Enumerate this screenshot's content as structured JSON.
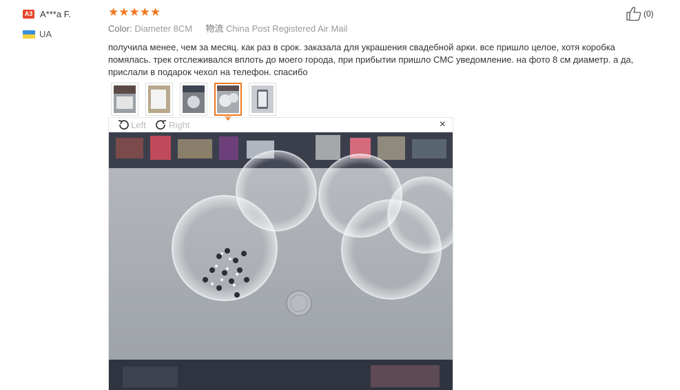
{
  "reviewer": {
    "level_badge": "A3",
    "name": "A***a F.",
    "country_code": "UA"
  },
  "rating": {
    "stars": 5,
    "max": 5,
    "star_color": "#f0781e"
  },
  "helpful": {
    "count_label": "(0)"
  },
  "order_meta": {
    "color_key": "Color:",
    "color_value": "Diameter 8CM",
    "shipping_key": "物流",
    "shipping_value": "China Post Registered Air Mail"
  },
  "review_text": "получила менее, чем за месяц. как раз в срок. заказала для украшения свадебной арки. все пришло целое, хотя коробка помялась. трек отслеживался вплоть до моего города, при прибытии пришло СМС уведомление. на фото 8 см диаметр. а да, прислали в подарок чехол на телефон. спасибо",
  "thumbnails": {
    "count": 5,
    "active_index": 3
  },
  "viewer": {
    "rotate_left_label": "Left",
    "rotate_right_label": "Right",
    "close_label": "×"
  },
  "colors": {
    "accent": "#f0781e",
    "badge": "#e5462c"
  }
}
